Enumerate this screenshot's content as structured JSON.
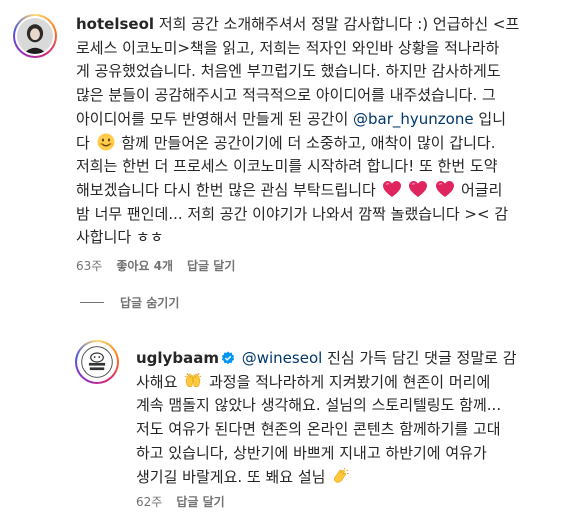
{
  "comment1": {
    "username": "hotelseol",
    "lines": [
      "저희 공간 소개해주셔서 정말 감사합니다 :) 언급하신 <프",
      "로세스 이코노미>책을 읽고, 저희는 적자인 와인바 상황을 적나라하",
      "게 공유했었습니다. 처음엔 부끄럽기도 했습니다. 하지만 감사하게도",
      "많은 분들이 공감해주시고 적극적으로 아이디어를 내주셨습니다. 그",
      "아이디어를 모두 반영해서 만들게 된 공간이",
      "입니",
      "다",
      "함께 만들어온 공간이기에 더 소중하고, 애착이 많이 갑니다.",
      "저희는 한번 더 프로세스 이코노미를 시작하려 합니다! 또 한번 도약",
      "해보겠습니다 다시 한번 많은 관심 부탁드립니다",
      "어글리",
      "밤 너무 팬인데... 저희 공간 이야기가 나와서 깜짝 놀랬습니다 >< 감",
      "사합니다 ㅎㅎ"
    ],
    "mention": "@bar_hyunzone",
    "time": "63주",
    "likes": "좋아요 4개",
    "reply": "답글 달기"
  },
  "hide_replies": "답글 숨기기",
  "comment2": {
    "username": "uglybaam",
    "mention": "@wineseol",
    "lines": [
      "진심 가득 담긴 댓글 정말로 감",
      "사해요",
      "과정을 적나라하게 지켜봤기에 현존이 머리에",
      "계속 맴돌지 않았나 생각해요. 설님의 스토리텔링도 함께...",
      "저도 여유가 된다면 현존의 온라인 콘텐츠 함께하기를 고대",
      "하고 있습니다, 상반기에 바쁘게 지내고 하반기에 여유가",
      "생기길 바랄게요. 또 봬요 설님"
    ],
    "time": "62주",
    "reply": "답글 달기"
  },
  "icons": {
    "avatar1": "woman-portrait-avatar",
    "avatar2": "uglybaam-logo-avatar",
    "verified": "verified-badge-icon",
    "emoji_smile": "smiling-face-emoji",
    "emoji_heart": "heart-emoji",
    "emoji_hands": "raising-hands-emoji",
    "emoji_clap": "clapping-hands-emoji"
  },
  "colors": {
    "text": "#262626",
    "secondary": "#737373",
    "link": "#00376b",
    "verified": "#0095f6",
    "heart": "#e0245e"
  }
}
